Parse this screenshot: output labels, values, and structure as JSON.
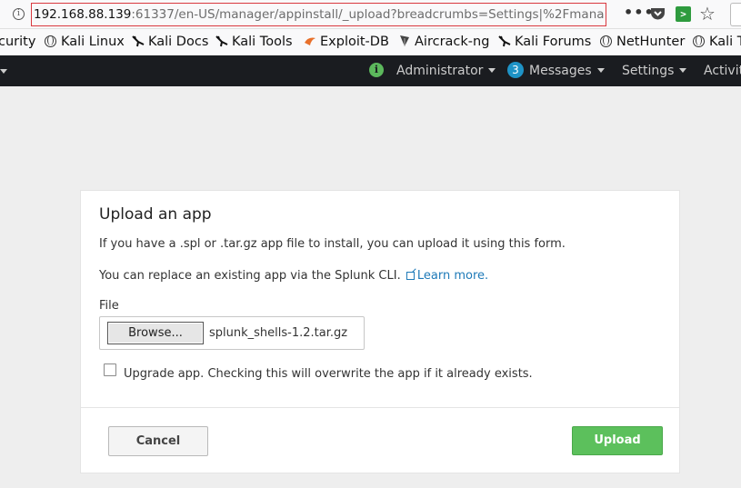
{
  "browser": {
    "url_host": "192.168.88.139",
    "url_rest": ":61337/en-US/manager/appinstall/_upload?breadcrumbs=Settings|%2Fmana",
    "menu_dots": "•••",
    "ext_label": ">",
    "info_glyph": "i",
    "star_glyph": "☆"
  },
  "bookmarks": [
    {
      "label": "curity",
      "icon": "none"
    },
    {
      "label": "Kali Linux",
      "icon": "globe-icon"
    },
    {
      "label": "Kali Docs",
      "icon": "kali-dragon-icon"
    },
    {
      "label": "Kali Tools",
      "icon": "kali-dragon-icon"
    },
    {
      "label": "Exploit-DB",
      "icon": "exploitdb-icon"
    },
    {
      "label": "Aircrack-ng",
      "icon": "aircrack-icon"
    },
    {
      "label": "Kali Forums",
      "icon": "kali-dragon-icon"
    },
    {
      "label": "NetHunter",
      "icon": "globe-icon"
    },
    {
      "label": "Kali T",
      "icon": "globe-icon"
    }
  ],
  "nav": {
    "health_glyph": "i",
    "administrator": "Administrator",
    "messages_count": "3",
    "messages": "Messages",
    "settings": "Settings",
    "activity": "Activity"
  },
  "dialog": {
    "title": "Upload an app",
    "intro": "If you have a .spl or .tar.gz app file to install, you can upload it using this form.",
    "cli_text": "You can replace an existing app via the Splunk CLI.",
    "learn_more": "Learn more.",
    "file_label": "File",
    "browse_label": "Browse...",
    "file_name": "splunk_shells-1.2.tar.gz",
    "upgrade_label": "Upgrade app. Checking this will overwrite the app if it already exists.",
    "upgrade_checked": false,
    "cancel_label": "Cancel",
    "upload_label": "Upload"
  },
  "colors": {
    "nav_bg": "#1a1c20",
    "upload_green": "#5cc05c",
    "link_blue": "#1e7ab8",
    "badge_blue": "#1e93c6"
  }
}
